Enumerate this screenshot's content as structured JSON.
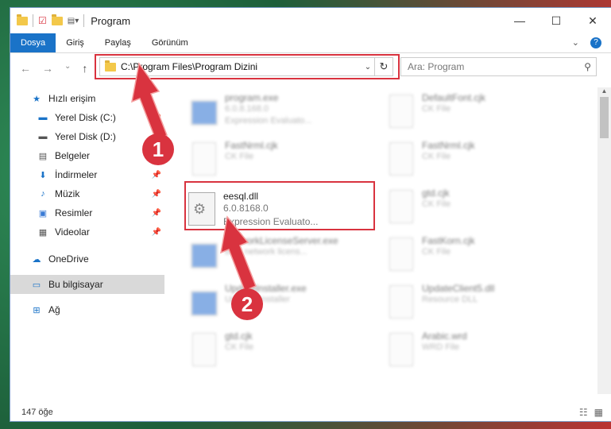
{
  "window": {
    "title": "Program"
  },
  "ribbon": {
    "tabs": [
      "Dosya",
      "Giriş",
      "Paylaş",
      "Görünüm"
    ],
    "help": "?"
  },
  "address": {
    "path": "C:\\Program Files\\Program Dizini",
    "search_placeholder": "Ara: Program"
  },
  "sidebar": {
    "items": [
      {
        "label": "Hızlı erişim",
        "icon": "star-icon"
      },
      {
        "label": "Yerel Disk (C:)",
        "icon": "drive-icon",
        "pinned": true
      },
      {
        "label": "Yerel Disk (D:)",
        "icon": "drive-icon",
        "pinned": true
      },
      {
        "label": "Belgeler",
        "icon": "document-icon",
        "pinned": true
      },
      {
        "label": "İndirmeler",
        "icon": "download-icon",
        "pinned": true
      },
      {
        "label": "Müzik",
        "icon": "music-icon",
        "pinned": true
      },
      {
        "label": "Resimler",
        "icon": "picture-icon",
        "pinned": true
      },
      {
        "label": "Videolar",
        "icon": "video-icon",
        "pinned": true
      },
      {
        "label": "OneDrive",
        "icon": "cloud-icon"
      },
      {
        "label": "Bu bilgisayar",
        "icon": "computer-icon",
        "selected": true
      },
      {
        "label": "Ağ",
        "icon": "network-icon"
      }
    ]
  },
  "files": [
    {
      "name": "program.exe",
      "line1": "6.0.8.168.0",
      "line2": "Expression Evaluato..."
    },
    {
      "name": "DefaultFont.cjk",
      "line1": "CK File",
      "line2": ""
    },
    {
      "name": "FastNrml.cjk",
      "line1": "CK File",
      "line2": ""
    },
    {
      "name": "FastNrml.cjk",
      "line1": "CK File",
      "line2": ""
    },
    {
      "name": "NetworkLicenseServer.exe",
      "line1": "BBY network licens...",
      "line2": ""
    },
    {
      "name": "gtd.cjk",
      "line1": "CK File",
      "line2": ""
    },
    {
      "name": "UpdateInstaller.exe",
      "line1": "Updates installer",
      "line2": ""
    },
    {
      "name": "FastKorn.cjk",
      "line1": "CK File",
      "line2": ""
    },
    {
      "name": "gtd.cjk",
      "line1": "CK File",
      "line2": ""
    },
    {
      "name": "UpdateClient5.dll",
      "line1": "Resource DLL",
      "line2": ""
    },
    {
      "name": "Arabic.wrd",
      "line1": "WRD File",
      "line2": ""
    }
  ],
  "highlighted_file": {
    "name": "eesql.dll",
    "version": "6.0.8168.0",
    "description": "Expression Evaluato..."
  },
  "annotations": {
    "step1": "1",
    "step2": "2"
  },
  "status": {
    "count": "147 öğe"
  },
  "colors": {
    "accent": "#1a73c8",
    "highlight": "#d9333f"
  }
}
